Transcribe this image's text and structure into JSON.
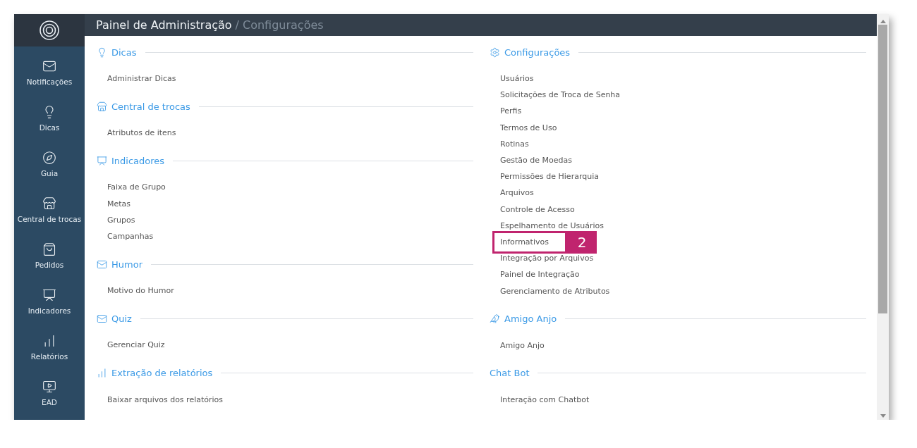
{
  "header": {
    "title": "Painel de Administração",
    "separator": "/",
    "subtitle": "Configurações"
  },
  "sidebar": {
    "items": [
      {
        "label": "Notificações"
      },
      {
        "label": "Dicas"
      },
      {
        "label": "Guia"
      },
      {
        "label": "Central de trocas"
      },
      {
        "label": "Pedidos"
      },
      {
        "label": "Indicadores"
      },
      {
        "label": "Relatórios"
      },
      {
        "label": "EAD"
      }
    ]
  },
  "columns": [
    {
      "sections": [
        {
          "title": "Dicas",
          "items": [
            {
              "label": "Administrar Dicas"
            }
          ]
        },
        {
          "title": "Central de trocas",
          "items": [
            {
              "label": "Atributos de itens"
            }
          ]
        },
        {
          "title": "Indicadores",
          "items": [
            {
              "label": "Faixa de Grupo"
            },
            {
              "label": "Metas"
            },
            {
              "label": "Grupos"
            },
            {
              "label": "Campanhas"
            }
          ]
        },
        {
          "title": "Humor",
          "items": [
            {
              "label": "Motivo do Humor"
            }
          ]
        },
        {
          "title": "Quiz",
          "items": [
            {
              "label": "Gerenciar Quiz"
            }
          ]
        },
        {
          "title": "Extração de relatórios",
          "items": [
            {
              "label": "Baixar arquivos dos relatórios"
            }
          ]
        }
      ]
    },
    {
      "sections": [
        {
          "title": "Configurações",
          "items": [
            {
              "label": "Usuários"
            },
            {
              "label": "Solicitações de Troca de Senha"
            },
            {
              "label": "Perfis"
            },
            {
              "label": "Termos de Uso"
            },
            {
              "label": "Rotinas"
            },
            {
              "label": "Gestão de Moedas"
            },
            {
              "label": "Permissões de Hierarquia"
            },
            {
              "label": "Arquivos"
            },
            {
              "label": "Controle de Acesso"
            },
            {
              "label": "Espelhamento de Usuários"
            },
            {
              "label": "Informativos",
              "callout": "2"
            },
            {
              "label": "Integração por Arquivos"
            },
            {
              "label": "Painel de Integração"
            },
            {
              "label": "Gerenciamento de Atributos"
            }
          ]
        },
        {
          "title": "Amigo Anjo",
          "items": [
            {
              "label": "Amigo Anjo"
            }
          ]
        },
        {
          "title": "Chat Bot",
          "items": [
            {
              "label": "Interação com Chatbot"
            }
          ]
        }
      ]
    }
  ]
}
